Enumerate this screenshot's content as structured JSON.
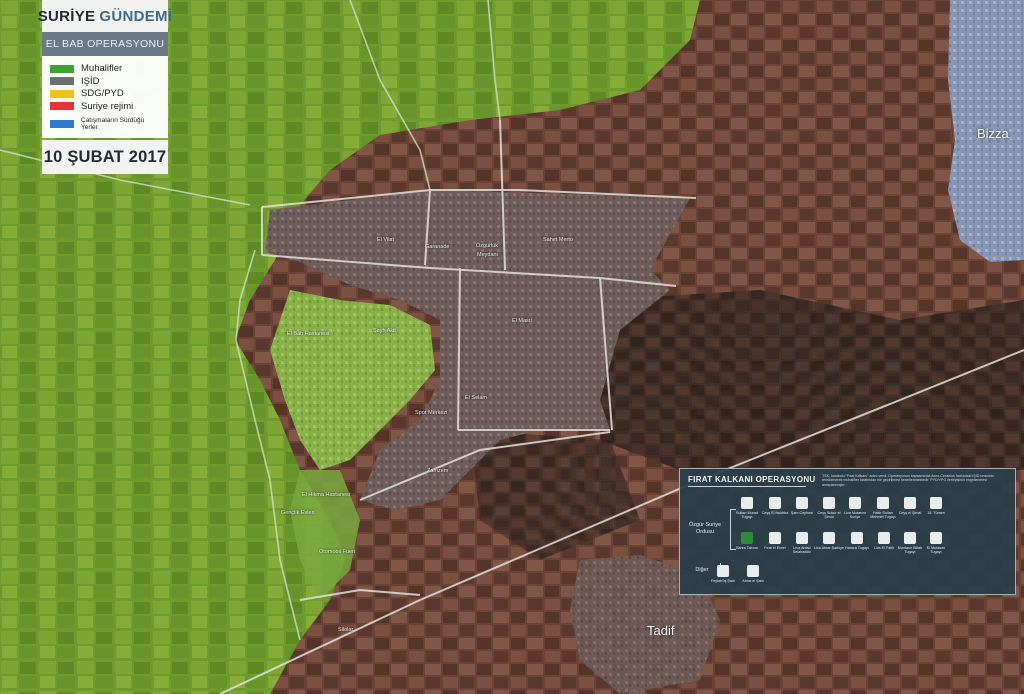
{
  "header": {
    "brand_part1": "SURİYE",
    "brand_part2": "GÜNDEMİ",
    "subtitle": "EL BAB OPERASYONU",
    "date": "10 ŞUBAT 2017"
  },
  "legend": [
    {
      "label": "Muhalifler",
      "color": "#3fa12e"
    },
    {
      "label": "IŞİD",
      "color": "#6e6e6e"
    },
    {
      "label": "SDG/PYD",
      "color": "#f1c21b"
    },
    {
      "label": "Suriye rejimi",
      "color": "#e8333a"
    },
    {
      "label": "Çatışmaların Sürdüğü Yerler",
      "color": "#2a7bd0"
    }
  ],
  "places": {
    "bizza": "Bizza",
    "tadif": "Tadif",
    "el_vilat": "El Vilat",
    "garanade": "Garanade",
    "ozgurluk": "Özgürlük",
    "meydani": "Meydanı",
    "sahet_merto": "Sahet Merto",
    "seyh_akil": "Şeyh Akil",
    "el_bab_hastanesi": "El Bab Hastanesi",
    "el_masri": "El Masri",
    "el_selam": "El Selam",
    "spor_merkezi": "Spor Merkezi",
    "zamzem": "Zamzem",
    "el_hikma_hastanesi": "El Hikma Hastanesi",
    "genclik_evleri": "Gençlik Evleri",
    "otomobil_fueri": "Otomobil Fueri",
    "silolar": "Silolar"
  },
  "operation": {
    "title": "FIRAT KALKANI OPERASYONU",
    "description": "TSK, karakolu \"Fırat Kalkanı\" adını verdi. Operasyonun kapsamında Azez-Cerablus hattındaki IŞİD unsurları temizlenerek muhalifler tarafından ele geçirilmesi hedeflenmektedir. PYD/YPG ilerleyişinin engellenmesi amaçlanmıştır.",
    "group1_label": "Özgür Suriye Ordusu",
    "group2_label": "Diğer",
    "units_row1": [
      "Sultan Murad Tugayı",
      "Ceyş El Nukhba",
      "Şam Cephesi",
      "Ceyş Sukur el Şimal",
      "Liva Mutasım Suriye",
      "Fatih Sultan Mehmet Tugayı",
      "Ceyş el Şimal",
      "15. Tümen"
    ],
    "units_row2": [
      "Sahra Taburu",
      "Fırat el Evvel",
      "Liva Ahfad Selahaddin",
      "Liva Ahrar Şarkiye",
      "Hamza Tugayı",
      "Liva El Fatih",
      "Muntasır Billah Tugayı",
      "El Mutasım Tugayı"
    ],
    "units_row3": [
      "Feylak'üş Şam",
      "Ahrar el Şam"
    ]
  }
}
